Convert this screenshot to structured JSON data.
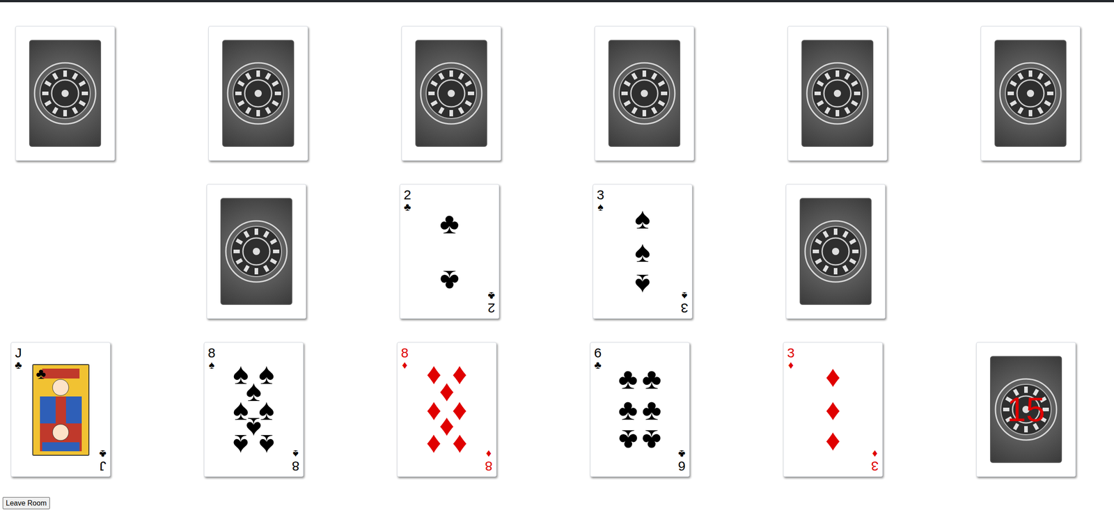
{
  "opponent_hand": [
    {
      "face_up": false
    },
    {
      "face_up": false
    },
    {
      "face_up": false
    },
    {
      "face_up": false
    },
    {
      "face_up": false
    },
    {
      "face_up": false
    }
  ],
  "table": [
    {
      "kind": "empty"
    },
    {
      "kind": "back"
    },
    {
      "kind": "card",
      "rank": "2",
      "suit": "♣",
      "color": "#000000"
    },
    {
      "kind": "card",
      "rank": "3",
      "suit": "♠",
      "color": "#000000"
    },
    {
      "kind": "back"
    },
    {
      "kind": "empty"
    }
  ],
  "player_hand": [
    {
      "rank": "J",
      "suit": "♣",
      "color": "#000000"
    },
    {
      "rank": "8",
      "suit": "♠",
      "color": "#000000"
    },
    {
      "rank": "8",
      "suit": "♦",
      "color": "#e00000"
    },
    {
      "rank": "6",
      "suit": "♣",
      "color": "#000000"
    },
    {
      "rank": "3",
      "suit": "♦",
      "color": "#e00000"
    }
  ],
  "deck": {
    "count": "15"
  },
  "buttons": [
    "Leave Room"
  ]
}
